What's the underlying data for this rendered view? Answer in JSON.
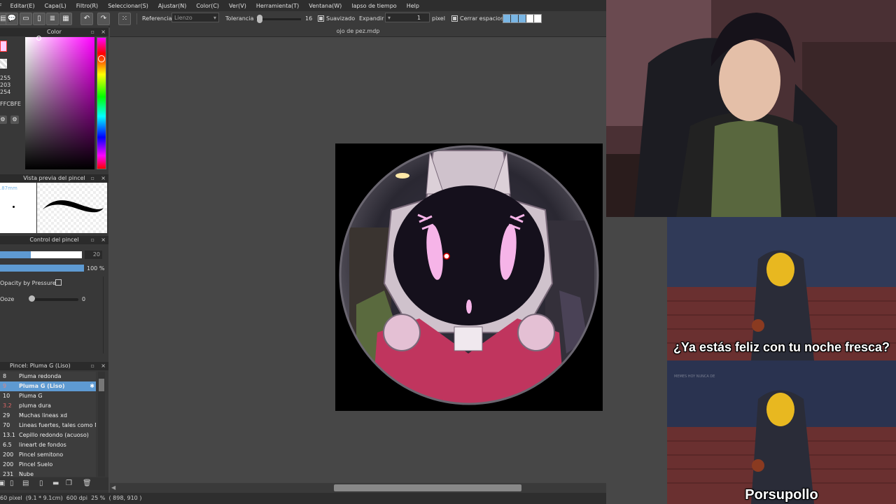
{
  "menu": [
    "F",
    "Editar(E)",
    "Capa(L)",
    "Filtro(R)",
    "Seleccionar(S)",
    "Ajustar(N)",
    "Color(C)",
    "Ver(V)",
    "Herramienta(T)",
    "Ventana(W)",
    "lapso de tiempo",
    "Help"
  ],
  "toolbar": {
    "referencia_label": "Referencia",
    "referencia_value": "Lienzo",
    "tolerancia_label": "Tolerancia",
    "tolerancia_value": "16",
    "suavizado_label": "Suavizado",
    "expandir_label": "Expandir",
    "expandir_value": "1",
    "expandir_unit": "pixel",
    "cerrar_label": "Cerrar espacios"
  },
  "document": {
    "title": "ojo de pez.mdp"
  },
  "color_panel": {
    "title": "Color",
    "r": "255",
    "g": "203",
    "b": "254",
    "hex": "FFCBFE",
    "current_color": "#ffcbfe"
  },
  "brush_preview": {
    "title": "Vista previa del pincel",
    "size": ".87mm"
  },
  "brush_control": {
    "title": "Control del pincel",
    "size_value": "20",
    "size_fraction": 0.38,
    "opacity_value": "100 %",
    "opacity_fraction": 1.0,
    "opacity_pressure_label": "Opacity by Pressure",
    "ooze_label": "Ooze",
    "ooze_value": "0"
  },
  "brush_list": {
    "title": "Pincel: Pluma G (Liso)",
    "items": [
      {
        "size": "8",
        "name": "Pluma redonda"
      },
      {
        "size": "9",
        "name": "Pluma G (Liso)",
        "selected": true
      },
      {
        "size": "10",
        "name": "Pluma G"
      },
      {
        "size": "3.2",
        "name": "pluma dura"
      },
      {
        "size": "29",
        "name": "Muchas lineas xd"
      },
      {
        "size": "70",
        "name": "Lineas fuertes, tales como Ma"
      },
      {
        "size": "13.1",
        "name": "Cepillo redondo (acuoso)"
      },
      {
        "size": "6.5",
        "name": "lineart de fondos"
      },
      {
        "size": "200",
        "name": "Pincel semitono"
      },
      {
        "size": "200",
        "name": "Pincel Suelo"
      },
      {
        "size": "231",
        "name": "Nube"
      }
    ]
  },
  "status": {
    "text": "60 pixel  (9.1 * 9.1cm)  600 dpi  25 %  ( 898, 910 )"
  },
  "meme": {
    "caption_top": "¿Ya estás feliz con tu noche fresca?",
    "caption_bottom": "Porsupollo",
    "watermark": "MEMES HOY NUNCA DE"
  },
  "colors": {
    "accent": "#5e9ad2",
    "panel": "#383838",
    "canvas": "#474747"
  }
}
